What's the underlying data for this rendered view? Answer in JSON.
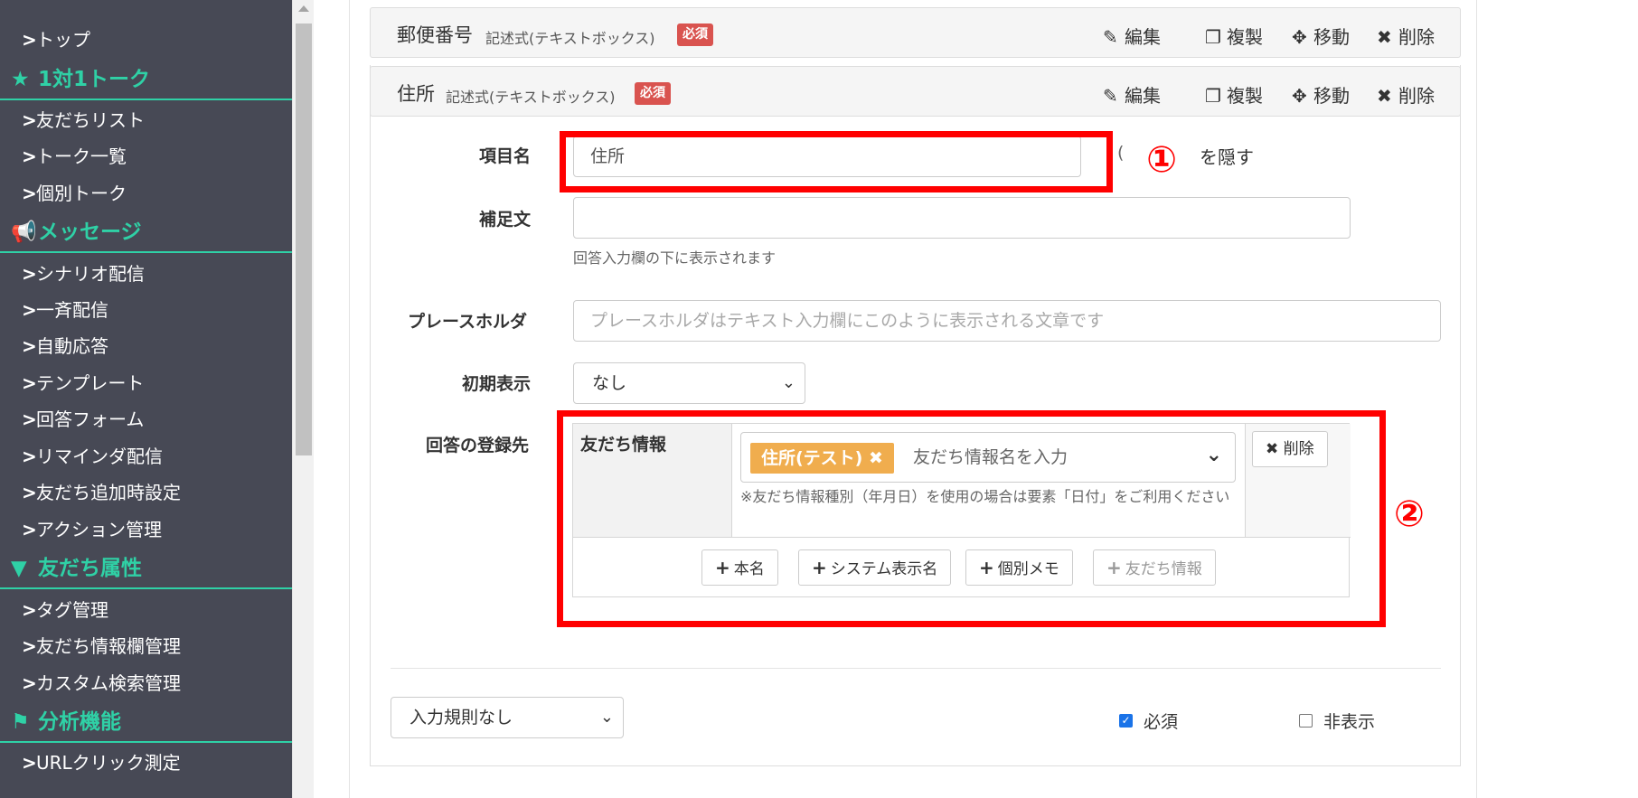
{
  "sidebar": {
    "items": [
      {
        "kind": "item",
        "label": "トップ"
      },
      {
        "kind": "head",
        "icon": "★",
        "label": "1対1トーク"
      },
      {
        "kind": "item",
        "label": "友だちリスト"
      },
      {
        "kind": "item",
        "label": "トーク一覧"
      },
      {
        "kind": "item",
        "label": "個別トーク"
      },
      {
        "kind": "head",
        "icon": "📢",
        "label": "メッセージ"
      },
      {
        "kind": "item",
        "label": "シナリオ配信"
      },
      {
        "kind": "item",
        "label": "一斉配信"
      },
      {
        "kind": "item",
        "label": "自動応答"
      },
      {
        "kind": "item",
        "label": "テンプレート"
      },
      {
        "kind": "item",
        "label": "回答フォーム"
      },
      {
        "kind": "item",
        "label": "リマインダ配信"
      },
      {
        "kind": "item",
        "label": "友だち追加時設定"
      },
      {
        "kind": "item",
        "label": "アクション管理"
      },
      {
        "kind": "head",
        "icon": "▼",
        "label": "友だち属性"
      },
      {
        "kind": "item",
        "label": "タグ管理"
      },
      {
        "kind": "item",
        "label": "友だち情報欄管理"
      },
      {
        "kind": "item",
        "label": "カスタム検索管理"
      },
      {
        "kind": "head",
        "icon": "⚑",
        "label": "分析機能"
      },
      {
        "kind": "item",
        "label": "URLクリック測定"
      }
    ]
  },
  "fields": [
    {
      "name": "郵便番号",
      "type": "記述式(テキストボックス)",
      "required": "必須"
    },
    {
      "name": "住所",
      "type": "記述式(テキストボックス)",
      "required": "必須"
    }
  ],
  "actions": {
    "edit": "編集",
    "duplicate": "複製",
    "move": "移動",
    "delete": "削除"
  },
  "form": {
    "item_name_label": "項目名",
    "item_name_value": "住所",
    "hide_label": "を隠す",
    "hide_paren": "(",
    "supplement_label": "補足文",
    "supplement_help": "回答入力欄の下に表示されます",
    "placeholder_label": "プレースホルダ",
    "placeholder_hint": "プレースホルダはテキスト入力欄にこのように表示される文章です",
    "initial_label": "初期表示",
    "initial_value": "なし",
    "dest_label": "回答の登録先"
  },
  "registration": {
    "kind_label": "友だち情報",
    "tag": "住所(テスト)",
    "tag_remove": "✖",
    "input_placeholder": "友だち情報名を入力",
    "note": "※友だち情報種別（年月日）を使用の場合は要素「日付」をご利用ください",
    "delete_button": "削除",
    "add_buttons": [
      "本名",
      "システム表示名",
      "個別メモ",
      "友だち情報"
    ]
  },
  "footer": {
    "rule_select": "入力規則なし",
    "required_label": "必須",
    "hidden_label": "非表示"
  },
  "annotations": {
    "one": "①",
    "two": "②"
  }
}
